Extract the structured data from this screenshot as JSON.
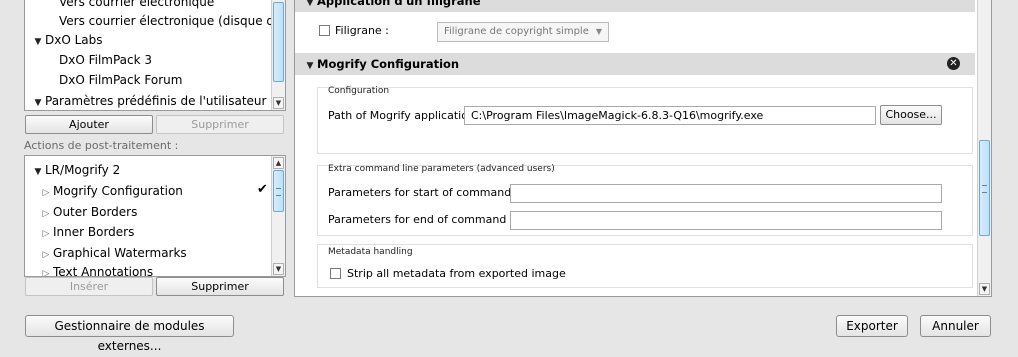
{
  "presets": {
    "items": [
      {
        "label": "Vers courrier électronique",
        "type": "child"
      },
      {
        "label": "Vers courrier électronique (disque dur)",
        "type": "child"
      },
      {
        "label": "DxO Labs",
        "type": "group"
      },
      {
        "label": "DxO FilmPack 3",
        "type": "child"
      },
      {
        "label": "DxO FilmPack Forum",
        "type": "child"
      },
      {
        "label": "Paramètres prédéfinis de l'utilisateur",
        "type": "group"
      }
    ],
    "add_label": "Ajouter",
    "remove_label": "Supprimer"
  },
  "post_actions": {
    "title": "Actions de post-traitement :",
    "group_label": "LR/Mogrify 2",
    "items": [
      {
        "label": "Mogrify Configuration",
        "checked": true
      },
      {
        "label": "Outer Borders",
        "checked": false
      },
      {
        "label": "Inner Borders",
        "checked": false
      },
      {
        "label": "Graphical Watermarks",
        "checked": false
      },
      {
        "label": "Text Annotations",
        "checked": false
      }
    ],
    "check_glyph": "✔",
    "insert_label": "Insérer",
    "remove_label": "Supprimer"
  },
  "watermark": {
    "section_title": "Application d'un filigrane",
    "checkbox_label": "Filigrane :",
    "select_value": "Filigrane de copyright simple"
  },
  "mogrify": {
    "section_title": "Mogrify Configuration",
    "config_group_title": "Configuration",
    "path_label": "Path of Mogrify application:",
    "path_value": "C:\\Program Files\\ImageMagick-6.8.3-Q16\\mogrify.exe",
    "choose_label": "Choose...",
    "extra_group_title": "Extra command line parameters (advanced users)",
    "start_label": "Parameters for start of command line:",
    "start_value": "",
    "end_label": "Parameters for end of command line:",
    "end_value": "",
    "metadata_group_title": "Metadata handling",
    "strip_label": "Strip all metadata from exported image"
  },
  "footer": {
    "plugin_manager_label": "Gestionnaire de modules externes...",
    "export_label": "Exporter",
    "cancel_label": "Annuler"
  },
  "icons": {
    "expanded": "▼",
    "collapsed": "▷",
    "scroll_up": "▲",
    "scroll_down": "▼",
    "close": "✕"
  }
}
